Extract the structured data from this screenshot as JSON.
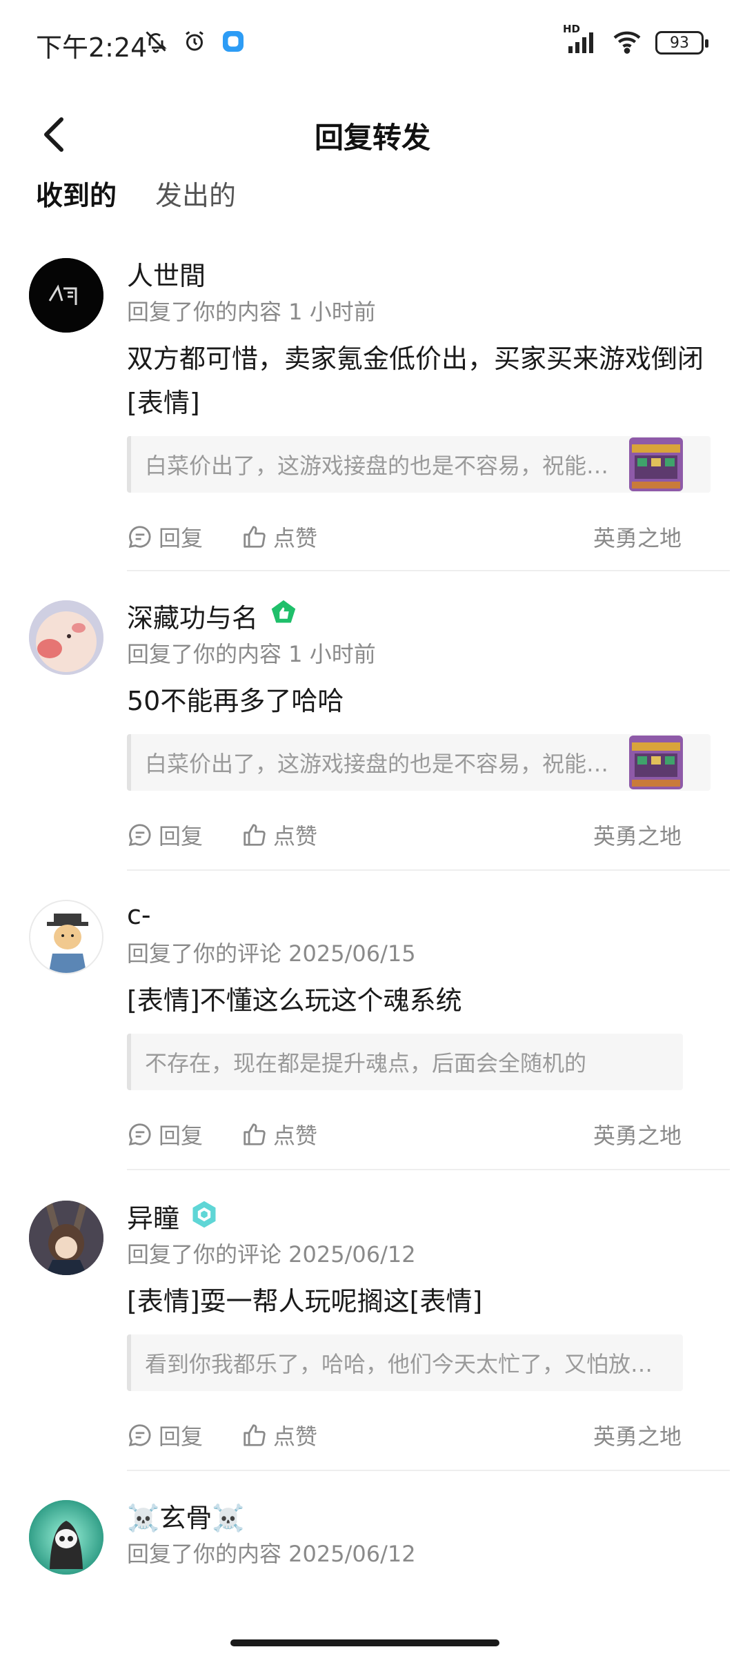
{
  "status_bar": {
    "time": "下午2:24",
    "battery": "93",
    "hd_label": "HD"
  },
  "header": {
    "title": "回复转发",
    "back_icon": "chevron-left-icon"
  },
  "tabs": [
    {
      "label": "收到的",
      "active": true
    },
    {
      "label": "发出的",
      "active": false
    }
  ],
  "actions": {
    "reply_label": "回复",
    "like_label": "点赞"
  },
  "items": [
    {
      "username": "人世間",
      "meta": "回复了你的内容 1 小时前",
      "reply_text": "双方都可惜，卖家氪金低价出，买家买来游戏倒闭[表情]",
      "quote": "白菜价出了，这游戏接盘的也是不容易，祝能…",
      "has_thumb": true,
      "game": "英勇之地",
      "badge": "none"
    },
    {
      "username": "深藏功与名",
      "meta": "回复了你的内容 1 小时前",
      "reply_text": "50不能再多了哈哈",
      "quote": "白菜价出了，这游戏接盘的也是不容易，祝能…",
      "has_thumb": true,
      "game": "英勇之地",
      "badge": "green-shield"
    },
    {
      "username": "c-",
      "meta": "回复了你的评论 2025/06/15",
      "reply_text": "[表情]不懂这么玩这个魂系统",
      "quote": "不存在，现在都是提升魂点，后面会全随机的",
      "has_thumb": false,
      "game": "英勇之地",
      "badge": "none"
    },
    {
      "username": "异瞳",
      "meta": "回复了你的评论 2025/06/12",
      "reply_text": "[表情]耍一帮人玩呢搁这[表情]",
      "quote": "看到你我都乐了，哈哈，他们今天太忙了，又怕放…",
      "has_thumb": false,
      "game": "英勇之地",
      "badge": "teal-hexagon"
    },
    {
      "username": "☠️玄骨☠️",
      "meta": "回复了你的内容 2025/06/12",
      "badge": "none"
    }
  ]
}
